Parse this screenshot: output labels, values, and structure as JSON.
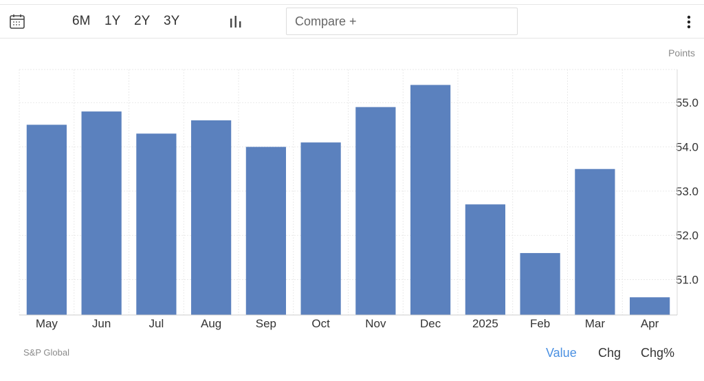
{
  "toolbar": {
    "calendar_icon": "calendar-icon",
    "ranges": [
      "6M",
      "1Y",
      "2Y",
      "3Y"
    ],
    "chart_type_icon": "bar-chart-icon",
    "compare_label": "Compare +",
    "more_icon": "kebab-menu-icon"
  },
  "unit_label": "Points",
  "source": "S&P Global",
  "view_tabs": [
    {
      "label": "Value",
      "active": true
    },
    {
      "label": "Chg",
      "active": false
    },
    {
      "label": "Chg%",
      "active": false
    }
  ],
  "colors": {
    "bar": "#5b81be",
    "active_tab": "#4a90e2",
    "grid": "#e9e9e9"
  },
  "chart_data": {
    "type": "bar",
    "categories": [
      "May",
      "Jun",
      "Jul",
      "Aug",
      "Sep",
      "Oct",
      "Nov",
      "Dec",
      "2025",
      "Feb",
      "Mar",
      "Apr"
    ],
    "values": [
      54.5,
      54.8,
      54.3,
      54.6,
      54.0,
      54.1,
      54.9,
      55.4,
      52.7,
      51.6,
      53.5,
      50.6
    ],
    "yticks": [
      "51.0",
      "52.0",
      "53.0",
      "54.0",
      "55.0"
    ],
    "ylim": [
      50.2,
      55.75
    ],
    "ylabel": "Points",
    "grid": true
  }
}
